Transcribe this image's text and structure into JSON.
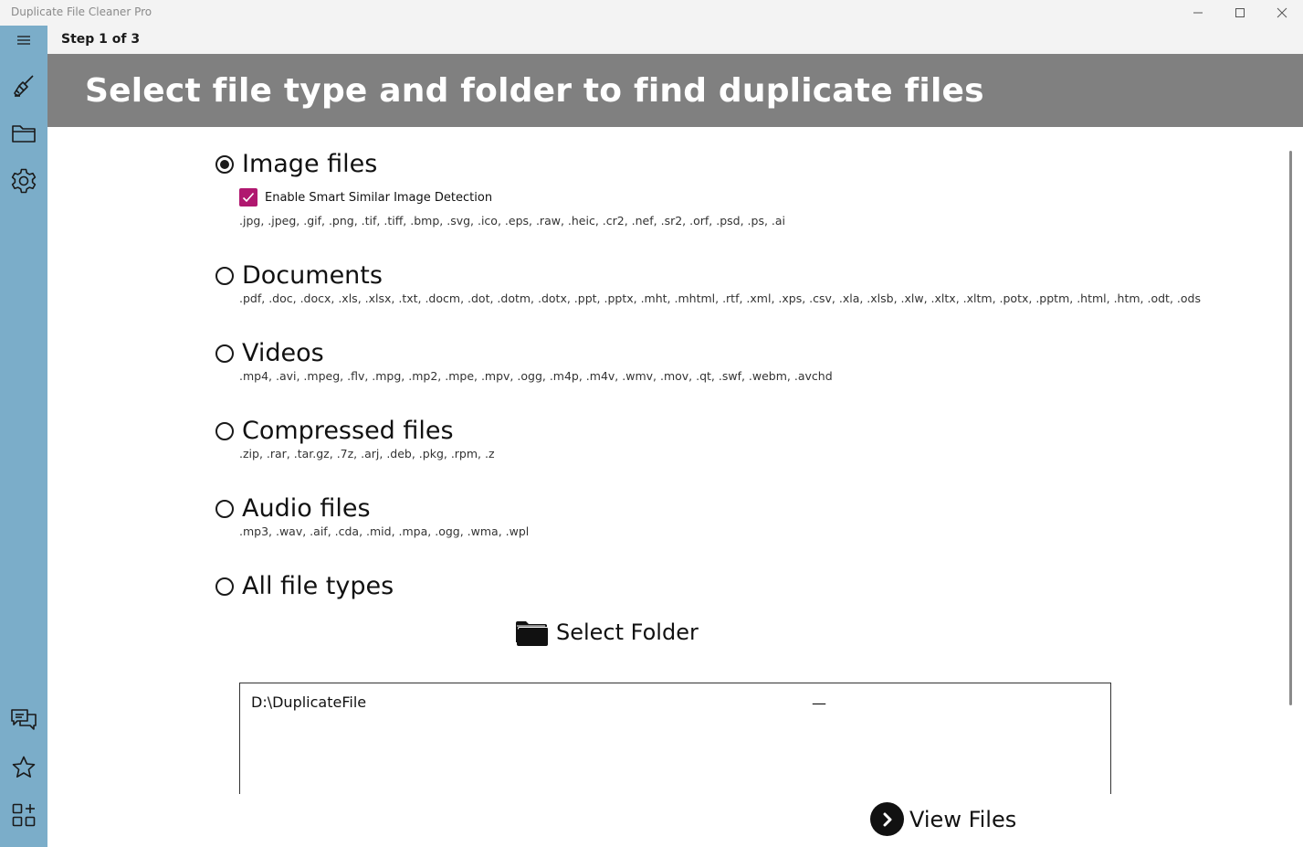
{
  "window": {
    "title": "Duplicate File Cleaner Pro",
    "controls": [
      "minimize-icon",
      "maximize-icon",
      "close-icon"
    ]
  },
  "sidebar": {
    "items": [
      {
        "icon": "hamburger-menu-icon"
      },
      {
        "icon": "broom-icon"
      },
      {
        "icon": "folder-icon"
      },
      {
        "icon": "gear-icon"
      },
      {
        "icon": "chat-icon"
      },
      {
        "icon": "star-icon"
      },
      {
        "icon": "apps-add-icon"
      }
    ]
  },
  "header": {
    "step": "Step 1 of 3",
    "title": "Select file type and folder to find duplicate files"
  },
  "options": [
    {
      "label": "Image files",
      "selected": true,
      "extensions": ".jpg, .jpeg, .gif, .png, .tif, .tiff, .bmp, .svg, .ico, .eps, .raw, .heic, .cr2, .nef, .sr2, .orf, .psd, .ps, .ai"
    },
    {
      "label": "Documents",
      "selected": false,
      "extensions": ".pdf, .doc, .docx, .xls, .xlsx, .txt, .docm, .dot, .dotm, .dotx, .ppt, .pptx, .mht, .mhtml, .rtf, .xml, .xps, .csv, .xla, .xlsb, .xlw, .xltx, .xltm, .potx, .pptm, .html, .htm, .odt, .ods"
    },
    {
      "label": "Videos",
      "selected": false,
      "extensions": ".mp4, .avi, .mpeg, .flv, .mpg, .mp2, .mpe, .mpv, .ogg, .m4p, .m4v, .wmv, .mov, .qt, .swf, .webm, .avchd"
    },
    {
      "label": "Compressed files",
      "selected": false,
      "extensions": ".zip, .rar, .tar.gz, .7z, .arj, .deb, .pkg, .rpm, .z"
    },
    {
      "label": "Audio files",
      "selected": false,
      "extensions": ".mp3, .wav, .aif, .cda, .mid, .mpa, .ogg, .wma, .wpl"
    },
    {
      "label": "All file types",
      "selected": false,
      "extensions": ""
    }
  ],
  "smart_detection": {
    "label": "Enable Smart Similar Image Detection",
    "checked": true
  },
  "select_folder": {
    "label": "Select Folder"
  },
  "folder_list": {
    "path": "D:\\DuplicateFile",
    "remove": "—"
  },
  "view_files": {
    "label": "View Files"
  },
  "colors": {
    "sidebar": "#7badc9",
    "banner": "#808080",
    "accent": "#b0176f"
  }
}
